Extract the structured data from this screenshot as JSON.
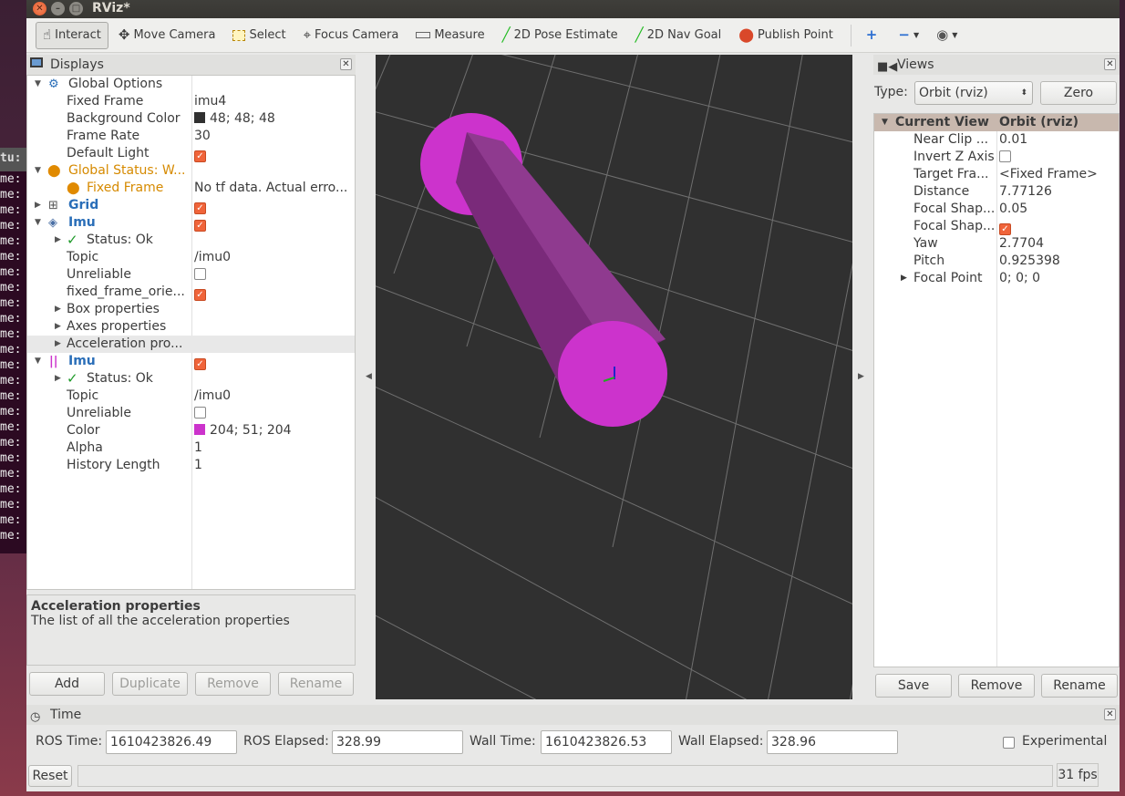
{
  "terminal": {
    "title": "tu: ~",
    "lines": [
      "me:",
      "me:",
      "me:",
      "me:",
      "me:",
      "me:",
      "me:",
      "me:",
      "me:",
      "me:",
      "me:",
      "me:",
      "me:",
      "me:",
      "me:",
      "me:",
      "me:",
      "me:",
      "me:",
      "me:",
      "me:",
      "me:",
      "me:",
      "me:"
    ]
  },
  "window": {
    "title": "RViz*"
  },
  "toolbar": {
    "tools": [
      {
        "label": "Interact",
        "icon": "hand-pointer-icon"
      },
      {
        "label": "Move Camera",
        "icon": "move-camera-icon"
      },
      {
        "label": "Select",
        "icon": "select-rect-icon"
      },
      {
        "label": "Focus Camera",
        "icon": "focus-target-icon"
      },
      {
        "label": "Measure",
        "icon": "ruler-icon"
      },
      {
        "label": "2D Pose Estimate",
        "icon": "green-arrow-icon"
      },
      {
        "label": "2D Nav Goal",
        "icon": "green-arrow-icon"
      },
      {
        "label": "Publish Point",
        "icon": "map-pin-icon"
      }
    ]
  },
  "displays": {
    "title": "Displays",
    "rows": [
      {
        "name": "Global Options",
        "value": ""
      },
      {
        "name": "Fixed Frame",
        "value": "imu4"
      },
      {
        "name": "Background Color",
        "value": "48; 48; 48"
      },
      {
        "name": "Frame Rate",
        "value": "30"
      },
      {
        "name": "Default Light",
        "value": ""
      },
      {
        "name": "Global Status: W...",
        "value": ""
      },
      {
        "name": "Fixed Frame",
        "value": "No tf data.  Actual erro..."
      },
      {
        "name": "Grid",
        "value": ""
      },
      {
        "name": "Imu",
        "value": ""
      },
      {
        "name": "Status: Ok",
        "value": ""
      },
      {
        "name": "Topic",
        "value": "/imu0"
      },
      {
        "name": "Unreliable",
        "value": ""
      },
      {
        "name": "fixed_frame_orie...",
        "value": ""
      },
      {
        "name": "Box properties",
        "value": ""
      },
      {
        "name": "Axes properties",
        "value": ""
      },
      {
        "name": "Acceleration pro...",
        "value": ""
      },
      {
        "name": "Imu",
        "value": ""
      },
      {
        "name": "Status: Ok",
        "value": ""
      },
      {
        "name": "Topic",
        "value": "/imu0"
      },
      {
        "name": "Unreliable",
        "value": ""
      },
      {
        "name": "Color",
        "value": "204; 51; 204"
      },
      {
        "name": "Alpha",
        "value": "1"
      },
      {
        "name": "History Length",
        "value": "1"
      }
    ],
    "description": {
      "title": "Acceleration properties",
      "text": "The list of all the acceleration properties"
    },
    "buttons": {
      "add": "Add",
      "duplicate": "Duplicate",
      "remove": "Remove",
      "rename": "Rename"
    },
    "colors": {
      "background_swatch": "#303030",
      "imu_swatch": "#cc33cc"
    }
  },
  "views": {
    "title": "Views",
    "type_label": "Type:",
    "type_value": "Orbit (rviz)",
    "zero_label": "Zero",
    "header": {
      "name": "Current View",
      "value": "Orbit (rviz)"
    },
    "rows": [
      {
        "name": "Near Clip ...",
        "value": "0.01"
      },
      {
        "name": "Invert Z Axis",
        "value": ""
      },
      {
        "name": "Target Fra...",
        "value": "<Fixed Frame>"
      },
      {
        "name": "Distance",
        "value": "7.77126"
      },
      {
        "name": "Focal Shap...",
        "value": "0.05"
      },
      {
        "name": "Focal Shap...",
        "value": ""
      },
      {
        "name": "Yaw",
        "value": "2.7704"
      },
      {
        "name": "Pitch",
        "value": "0.925398"
      },
      {
        "name": "Focal Point",
        "value": "0; 0; 0"
      }
    ],
    "buttons": {
      "save": "Save",
      "remove": "Remove",
      "rename": "Rename"
    }
  },
  "time": {
    "title": "Time",
    "ros_time_label": "ROS Time:",
    "ros_time": "1610423826.49",
    "ros_elapsed_label": "ROS Elapsed:",
    "ros_elapsed": "328.99",
    "wall_time_label": "Wall Time:",
    "wall_time": "1610423826.53",
    "wall_elapsed_label": "Wall Elapsed:",
    "wall_elapsed": "328.96",
    "experimental_label": "Experimental",
    "reset_label": "Reset",
    "fps": "31 fps"
  }
}
